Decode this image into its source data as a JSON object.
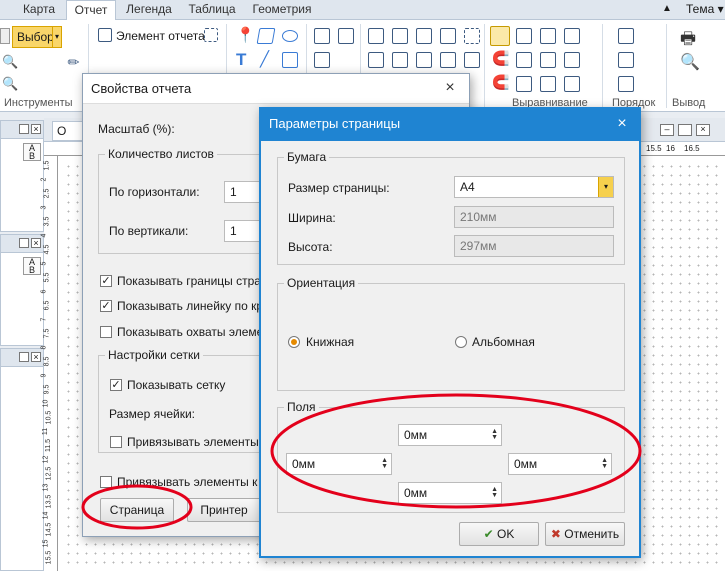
{
  "ribbon": {
    "tabs": [
      "Карта",
      "Отчет",
      "Легенда",
      "Таблица",
      "Геометрия"
    ],
    "active_tab": "Отчет",
    "theme_label": "Тема",
    "select_label": "Выбор",
    "report_element_label": "Элемент отчета",
    "groups": {
      "tools": "Инструменты",
      "align": "Выравнивание",
      "order": "Порядок",
      "output": "Вывод"
    }
  },
  "report_props": {
    "title": "Свойства отчета",
    "scale_label": "Масштаб (%):",
    "sheets_group": "Количество листов",
    "horiz_label": "По горизонтали:",
    "horiz_value": "1",
    "vert_label": "По вертикали:",
    "vert_value": "1",
    "checks": [
      {
        "label": "Показывать границы страни",
        "checked": true
      },
      {
        "label": "Показывать линейку по края",
        "checked": true
      },
      {
        "label": "Показывать охваты элементо",
        "checked": false
      }
    ],
    "grid_group": "Настройки сетки",
    "show_grid_label": "Показывать сетку",
    "show_grid_checked": true,
    "cell_size_label": "Размер ячейки:",
    "snap_grid_label": "Привязывать элементы к с",
    "snap_bottom_label": "Привязывать элементы к на",
    "page_button": "Страница",
    "printer_button": "Принтер"
  },
  "page_params": {
    "title": "Параметры страницы",
    "paper_group": "Бумага",
    "page_size_label": "Размер страницы:",
    "page_size_value": "A4",
    "width_label": "Ширина:",
    "width_value": "210мм",
    "height_label": "Высота:",
    "height_value": "297мм",
    "orientation_group": "Ориентация",
    "portrait_label": "Книжная",
    "landscape_label": "Альбомная",
    "orientation_selected": "portrait",
    "margins_group": "Поля",
    "margin_top": "0мм",
    "margin_left": "0мм",
    "margin_right": "0мм",
    "margin_bottom": "0мм",
    "ok_label": "OK",
    "cancel_label": "Отменить"
  },
  "document_tab_label": "О",
  "ruler": {
    "top_ticks": [
      "15.5",
      "16",
      "16.5"
    ],
    "side_ticks": [
      "1.5",
      "2",
      "2.5",
      "3",
      "3.5",
      "4",
      "4.5",
      "5",
      "5.5",
      "6",
      "6.5",
      "7",
      "7.5",
      "8",
      "8.5",
      "9",
      "9.5",
      "10",
      "10.5",
      "11",
      "11.5",
      "12",
      "12.5",
      "13",
      "13.5",
      "14",
      "14.5",
      "15",
      "15.5"
    ]
  },
  "colors": {
    "accent": "#1f84d2",
    "annotation": "#e3001b",
    "active_orange": "#e58a00"
  }
}
